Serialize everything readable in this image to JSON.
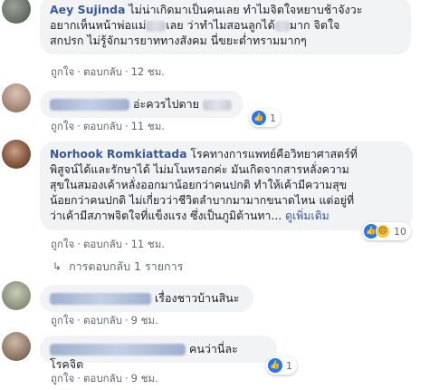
{
  "comments": [
    {
      "author": "Aey Sujinda",
      "text_line1_a": "ไม่น่าเกิดมาเป็นคนเลย ทำไมจิตใจหยาบช้าจังวะ",
      "text_line2_a": "อยากเห็นหน้าพ่อแม่",
      "text_line2_b": "เลย ว่าทำไมสอนลูกได้",
      "text_line2_c": "มาก จิตใจ",
      "text_line3": "สกปรก ไม่รู้จักมารยาททางสังคม นี่ขยะต่ำทรามมากๆ",
      "like": "ถูกใจ",
      "reply": "ตอบกลับ",
      "time": "12 ชม."
    },
    {
      "text": "อ่ะควรไปตาย",
      "like": "ถูกใจ",
      "reply": "ตอบกลับ",
      "time": "11 ชม.",
      "reactions": "1"
    },
    {
      "author": "Norhook Romkiattada",
      "line1": "โรคทางการแพทย์คือวิทยาศาสตร์ที่",
      "line2": "พิสูจน์ได้และรักษาได้ ไม่มโนหรอกค่ะ มันเกิดจากสารหลั่งความ",
      "line3": "สุขในสมองเค้าหลั่งออกมาน้อยกว่าคนปกติ ทำให้เค้ามีความสุข",
      "line4": "น้อยกว่าคนปกติ ไม่เกี่ยวว่าชีวิตลำบากมามากขนาดไหน แต่อยู่ที่",
      "line5": "ว่าเค้ามีสภาพจิตใจที่แข็งแรง ซึ่งเป็นภูมิต้านทา...",
      "see_more": "ดูเพิ่มเติม",
      "like": "ถูกใจ",
      "reply": "ตอบกลับ",
      "time": "11 ชม.",
      "reactions": "10"
    },
    {
      "text": "เรื่องชาวบ้านสินะ",
      "like": "ถูกใจ",
      "reply": "ตอบกลับ",
      "time": "9 ชม."
    },
    {
      "text": "คนว่านี่ละ โรคจิต",
      "like": "ถูกใจ",
      "reply": "ตอบกลับ",
      "time": "9 ชม.",
      "reactions": "1"
    }
  ],
  "replies_link": "การตอบกลับ 1 รายการ",
  "colors": {
    "link": "#385898",
    "bubble": "#f2f3f5",
    "like": "#2078f4",
    "muted": "#606770"
  },
  "icons": {
    "like": "thumbs-up-icon",
    "sad": "sad-face-icon",
    "reply_arrow": "reply-arrow-icon"
  }
}
